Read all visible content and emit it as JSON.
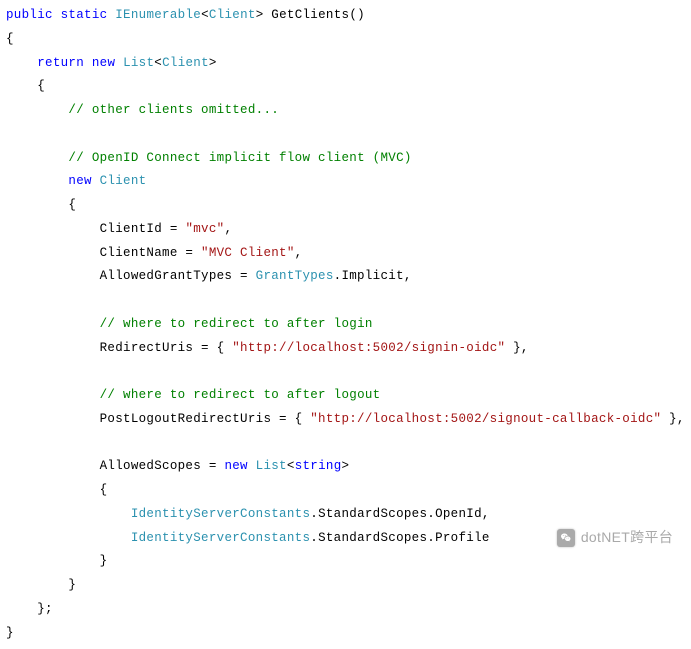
{
  "code": {
    "tokens": [
      [
        {
          "t": "public",
          "c": "kw"
        },
        {
          "t": " "
        },
        {
          "t": "static",
          "c": "kw"
        },
        {
          "t": " "
        },
        {
          "t": "IEnumerable",
          "c": "type"
        },
        {
          "t": "<"
        },
        {
          "t": "Client",
          "c": "type"
        },
        {
          "t": "> GetClients()"
        }
      ],
      [
        {
          "t": "{"
        }
      ],
      [
        {
          "t": "    "
        },
        {
          "t": "return",
          "c": "kw"
        },
        {
          "t": " "
        },
        {
          "t": "new",
          "c": "kw"
        },
        {
          "t": " "
        },
        {
          "t": "List",
          "c": "type"
        },
        {
          "t": "<"
        },
        {
          "t": "Client",
          "c": "type"
        },
        {
          "t": ">"
        }
      ],
      [
        {
          "t": "    {"
        }
      ],
      [
        {
          "t": "        "
        },
        {
          "t": "// other clients omitted...",
          "c": "cmt"
        }
      ],
      [
        {
          "t": ""
        }
      ],
      [
        {
          "t": "        "
        },
        {
          "t": "// OpenID Connect implicit flow client (MVC)",
          "c": "cmt"
        }
      ],
      [
        {
          "t": "        "
        },
        {
          "t": "new",
          "c": "kw"
        },
        {
          "t": " "
        },
        {
          "t": "Client",
          "c": "type"
        }
      ],
      [
        {
          "t": "        {"
        }
      ],
      [
        {
          "t": "            ClientId = "
        },
        {
          "t": "\"mvc\"",
          "c": "str"
        },
        {
          "t": ","
        }
      ],
      [
        {
          "t": "            ClientName = "
        },
        {
          "t": "\"MVC Client\"",
          "c": "str"
        },
        {
          "t": ","
        }
      ],
      [
        {
          "t": "            AllowedGrantTypes = "
        },
        {
          "t": "GrantTypes",
          "c": "type"
        },
        {
          "t": ".Implicit,"
        }
      ],
      [
        {
          "t": ""
        }
      ],
      [
        {
          "t": "            "
        },
        {
          "t": "// where to redirect to after login",
          "c": "cmt"
        }
      ],
      [
        {
          "t": "            RedirectUris = { "
        },
        {
          "t": "\"http://localhost:5002/signin-oidc\"",
          "c": "str"
        },
        {
          "t": " },"
        }
      ],
      [
        {
          "t": ""
        }
      ],
      [
        {
          "t": "            "
        },
        {
          "t": "// where to redirect to after logout",
          "c": "cmt"
        }
      ],
      [
        {
          "t": "            PostLogoutRedirectUris = { "
        },
        {
          "t": "\"http://localhost:5002/signout-callback-oidc\"",
          "c": "str"
        },
        {
          "t": " },"
        }
      ],
      [
        {
          "t": ""
        }
      ],
      [
        {
          "t": "            AllowedScopes = "
        },
        {
          "t": "new",
          "c": "kw"
        },
        {
          "t": " "
        },
        {
          "t": "List",
          "c": "type"
        },
        {
          "t": "<"
        },
        {
          "t": "string",
          "c": "kw"
        },
        {
          "t": ">"
        }
      ],
      [
        {
          "t": "            {"
        }
      ],
      [
        {
          "t": "                "
        },
        {
          "t": "IdentityServerConstants",
          "c": "type"
        },
        {
          "t": ".StandardScopes.OpenId,"
        }
      ],
      [
        {
          "t": "                "
        },
        {
          "t": "IdentityServerConstants",
          "c": "type"
        },
        {
          "t": ".StandardScopes.Profile"
        }
      ],
      [
        {
          "t": "            }"
        }
      ],
      [
        {
          "t": "        }"
        }
      ],
      [
        {
          "t": "    };"
        }
      ],
      [
        {
          "t": "}"
        }
      ]
    ]
  },
  "watermark": {
    "text": "dotNET跨平台"
  }
}
